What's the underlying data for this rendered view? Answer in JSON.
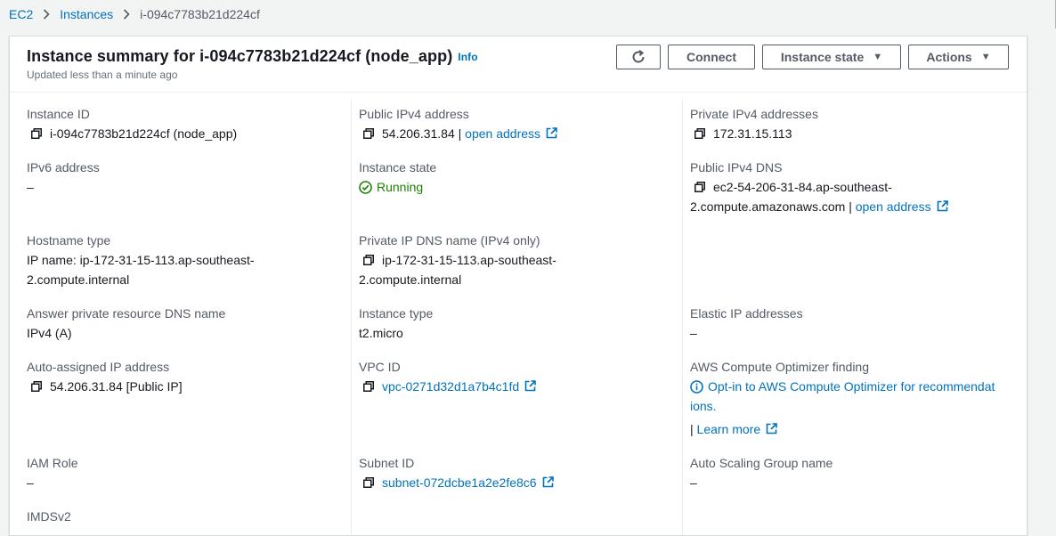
{
  "breadcrumb": {
    "ec2": "EC2",
    "instances": "Instances",
    "current": "i-094c7783b21d224cf"
  },
  "header": {
    "title": "Instance summary for i-094c7783b21d224cf (node_app)",
    "info": "Info",
    "subtitle": "Updated less than a minute ago",
    "connect": "Connect",
    "instance_state": "Instance state",
    "actions": "Actions"
  },
  "col1": {
    "instance_id_label": "Instance ID",
    "instance_id": "i-094c7783b21d224cf (node_app)",
    "ipv6_label": "IPv6 address",
    "ipv6": "–",
    "hostname_type_label": "Hostname type",
    "hostname_type_line1": "IP name: ip-172-31-15-113.ap-southeast-",
    "hostname_type_line2": "2.compute.internal",
    "answer_dns_label": "Answer private resource DNS name",
    "answer_dns": "IPv4 (A)",
    "auto_ip_label": "Auto-assigned IP address",
    "auto_ip": "54.206.31.84 [Public IP]",
    "iam_label": "IAM Role",
    "iam": "–",
    "imdsv2_label": "IMDSv2"
  },
  "col2": {
    "public_ipv4_label": "Public IPv4 address",
    "public_ipv4": "54.206.31.84",
    "sep": "|",
    "open_address": "open address",
    "state_label": "Instance state",
    "state": "Running",
    "private_dns_label": "Private IP DNS name (IPv4 only)",
    "private_dns_line1": "ip-172-31-15-113.ap-southeast-",
    "private_dns_line2": "2.compute.internal",
    "type_label": "Instance type",
    "type": "t2.micro",
    "vpc_label": "VPC ID",
    "vpc": "vpc-0271d32d1a7b4c1fd",
    "subnet_label": "Subnet ID",
    "subnet": "subnet-072dcbe1a2e2fe8c6"
  },
  "col3": {
    "private_ipv4_label": "Private IPv4 addresses",
    "private_ipv4": "172.31.15.113",
    "public_dns_label": "Public IPv4 DNS",
    "public_dns_line1": "ec2-54-206-31-84.ap-southeast-",
    "public_dns_line2": "2.compute.amazonaws.com",
    "sep": "|",
    "open_address": "open address",
    "elastic_label": "Elastic IP addresses",
    "elastic": "–",
    "optimizer_label": "AWS Compute Optimizer finding",
    "optimizer_line1": "Opt-in to AWS Compute Optimizer for recommendat",
    "optimizer_line2": "ions.",
    "learn_sep": "|",
    "learn_more": "Learn more",
    "asg_label": "Auto Scaling Group name",
    "asg": "–"
  },
  "colors": {
    "link": "#0073bb",
    "running": "#1d8102",
    "text": "#16191f",
    "label": "#545b64"
  }
}
